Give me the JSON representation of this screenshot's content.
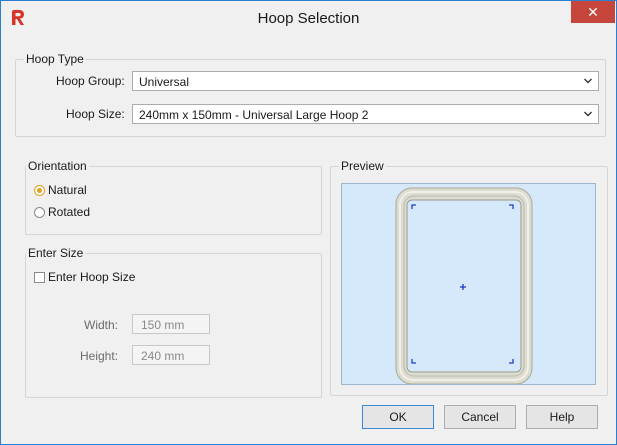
{
  "window": {
    "title": "Hoop Selection",
    "close_glyph": "✕",
    "icon": "app-logo-icon"
  },
  "hoop_type": {
    "legend": "Hoop Type",
    "group_label": "Hoop Group:",
    "group_value": "Universal",
    "size_label": "Hoop Size:",
    "size_value": "240mm x 150mm - Universal Large Hoop 2"
  },
  "orientation": {
    "legend": "Orientation",
    "options": [
      {
        "label": "Natural",
        "selected": true
      },
      {
        "label": "Rotated",
        "selected": false
      }
    ]
  },
  "enter_size": {
    "legend": "Enter Size",
    "checkbox_label": "Enter Hoop Size",
    "checked": false,
    "width_label": "Width:",
    "width_value": "150 mm",
    "height_label": "Height:",
    "height_value": "240 mm"
  },
  "preview": {
    "legend": "Preview"
  },
  "buttons": {
    "ok": "OK",
    "cancel": "Cancel",
    "help": "Help"
  },
  "colors": {
    "accent": "#2b7fd1",
    "close": "#c7463c",
    "radio_selected": "#e0a020",
    "preview_bg": "#d6e9fa",
    "marker": "#1a3fc8"
  }
}
